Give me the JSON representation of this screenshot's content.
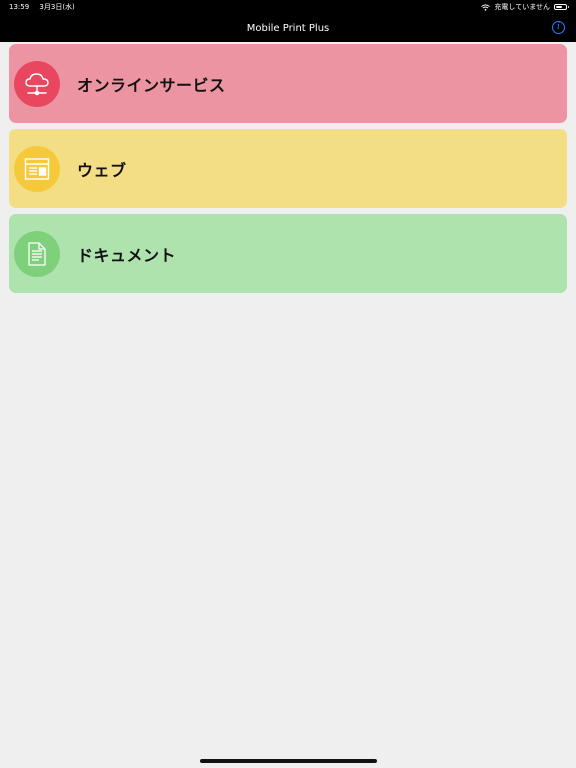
{
  "status_bar": {
    "time": "13:59",
    "date": "3月3日(水)",
    "charging_status": "充電していません",
    "battery_level": 0.7
  },
  "nav": {
    "title": "Mobile Print Plus",
    "info_label": "i"
  },
  "menu": {
    "items": [
      {
        "label": "オンラインサービス",
        "icon": "cloud-network-icon",
        "color": "#ec94a1",
        "icon_color": "#e8475f"
      },
      {
        "label": "ウェブ",
        "icon": "web-page-icon",
        "color": "#f4de85",
        "icon_color": "#f6c93a"
      },
      {
        "label": "ドキュメント",
        "icon": "document-icon",
        "color": "#aee3ae",
        "icon_color": "#7ed07a"
      }
    ]
  }
}
